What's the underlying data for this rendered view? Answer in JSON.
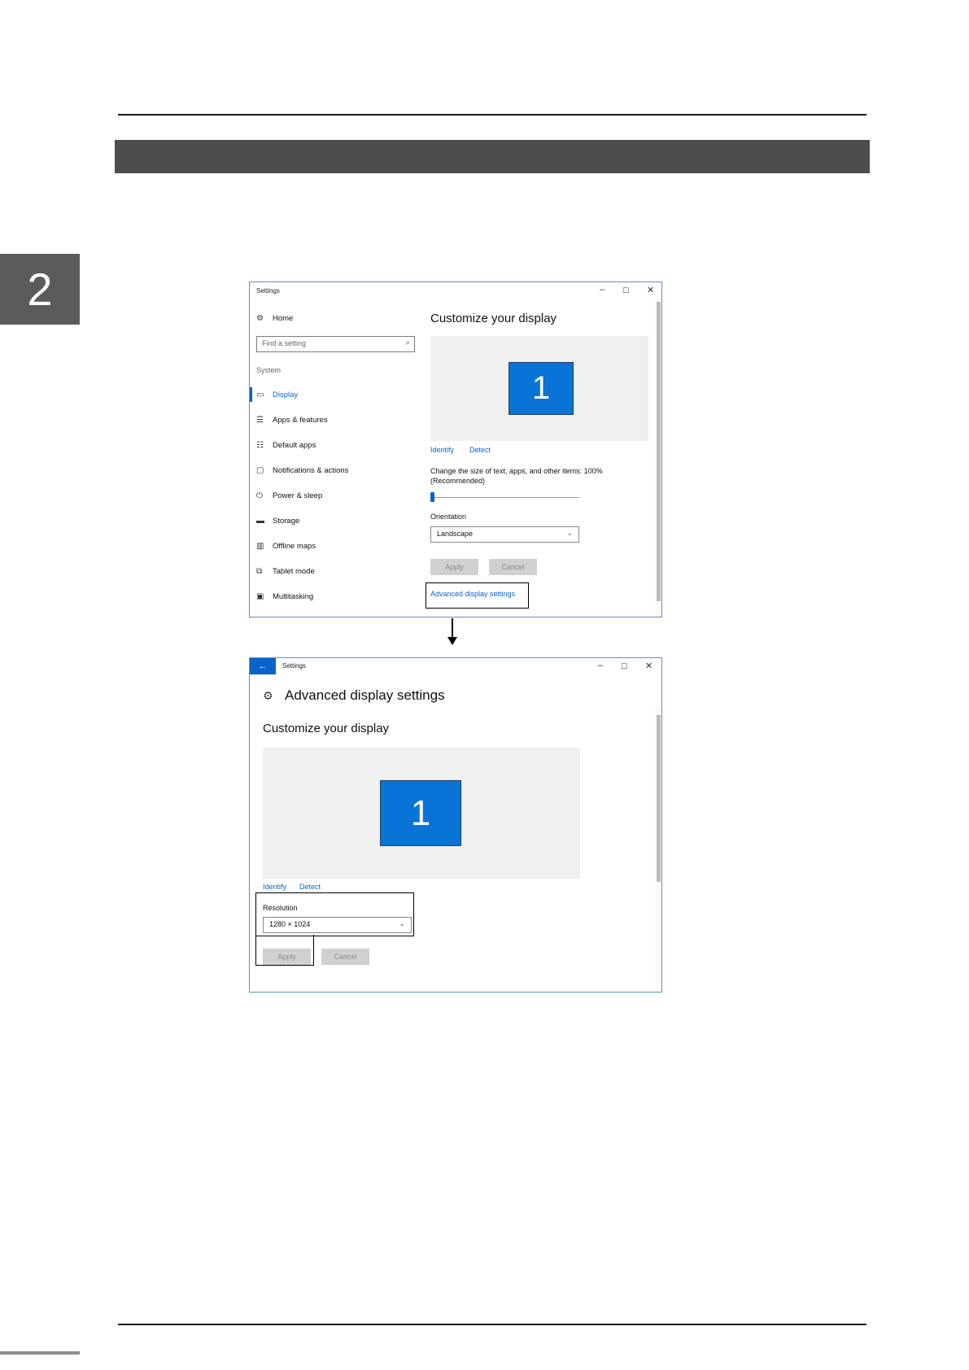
{
  "page": {
    "chapter_number": "2"
  },
  "window1": {
    "title": "Settings",
    "controls": {
      "minimize": "–",
      "maximize": "☐",
      "close": "✕"
    },
    "home_label": "Home",
    "search_placeholder": "Find a setting",
    "section_label": "System",
    "nav_items": [
      {
        "label": "Display",
        "icon": "monitor-icon",
        "active": true
      },
      {
        "label": "Apps & features",
        "icon": "list-icon",
        "active": false
      },
      {
        "label": "Default apps",
        "icon": "default-apps-icon",
        "active": false
      },
      {
        "label": "Notifications & actions",
        "icon": "notification-icon",
        "active": false
      },
      {
        "label": "Power & sleep",
        "icon": "power-icon",
        "active": false
      },
      {
        "label": "Storage",
        "icon": "storage-icon",
        "active": false
      },
      {
        "label": "Offline maps",
        "icon": "map-icon",
        "active": false
      },
      {
        "label": "Tablet mode",
        "icon": "tablet-icon",
        "active": false
      },
      {
        "label": "Multitasking",
        "icon": "multitasking-icon",
        "active": false
      }
    ],
    "heading": "Customize your display",
    "monitor_label": "1",
    "identify_link": "Identify",
    "detect_link": "Detect",
    "scale_text_line1": "Change the size of text, apps, and other items: 100%",
    "scale_text_line2": "(Recommended)",
    "scale_value_fraction": 0.0,
    "orientation_label": "Orientation",
    "orientation_value": "Landscape",
    "apply_label": "Apply",
    "cancel_label": "Cancel",
    "advanced_link": "Advanced display settings"
  },
  "window2": {
    "title": "Settings",
    "back_icon": "back-arrow-icon",
    "controls": {
      "minimize": "–",
      "maximize": "☐",
      "close": "✕"
    },
    "page_title": "Advanced display settings",
    "heading": "Customize your display",
    "monitor_label": "1",
    "identify_link": "Identify",
    "detect_link": "Detect",
    "resolution_label": "Resolution",
    "resolution_value": "1280 × 1024",
    "apply_label": "Apply",
    "cancel_label": "Cancel"
  },
  "colors": {
    "accent": "#0a63c9",
    "monitor": "#0a74d6",
    "header_bar": "#4d4d4d",
    "chapter_tab": "#5b5b5b"
  }
}
